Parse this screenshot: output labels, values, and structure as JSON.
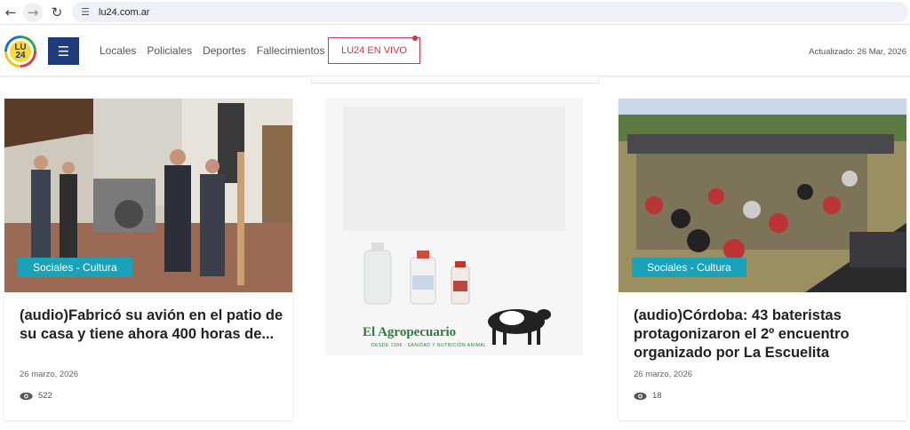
{
  "browser": {
    "url": "lu24.com.ar",
    "back_icon": "arrow-left-icon",
    "forward_icon": "arrow-right-icon",
    "reload_icon": "reload-icon",
    "site_info_icon": "tune-icon"
  },
  "header": {
    "logo_text_line1": "LU",
    "logo_text_line2": "24",
    "menu_icon": "hamburger-icon",
    "nav": [
      "Locales",
      "Policiales",
      "Deportes",
      "Fallecimientos"
    ],
    "live_label": "LU24 EN VIVO",
    "updated": "Actualizado: 26 Mar, 2026",
    "brand_color": "#1e3b7b",
    "live_color": "#d2374b"
  },
  "articles": [
    {
      "category": "Sociales - Cultura",
      "title": "(audio)Fabricó su avión en el patio de su casa y tiene ahora 400 horas de...",
      "date": "26 marzo, 2026",
      "views": "522"
    },
    {
      "category": "Sociales - Cultura",
      "title": "(audio)Córdoba: 43 bateristas protagonizaron el 2º encuentro organizado por La Escuelita",
      "date": "26 marzo, 2026",
      "views": "18"
    }
  ],
  "ad": {
    "brand": "El Agropecuario",
    "brand_sub": "DESDE 1996 · SANIDAD Y NUTRICIÓN ANIMAL"
  },
  "colors": {
    "badge": "#1aa2b8"
  }
}
